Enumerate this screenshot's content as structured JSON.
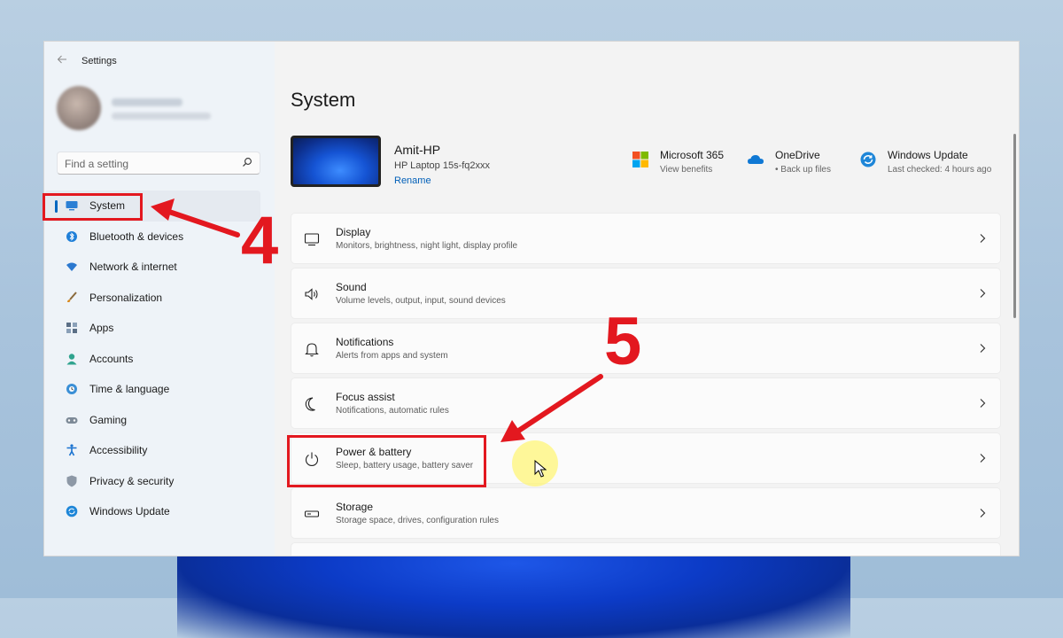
{
  "window": {
    "title": "Settings"
  },
  "sidebar": {
    "search_placeholder": "Find a setting",
    "items": [
      {
        "label": "System",
        "icon": "monitor-icon",
        "selected": true
      },
      {
        "label": "Bluetooth & devices",
        "icon": "bluetooth-icon"
      },
      {
        "label": "Network & internet",
        "icon": "wifi-icon"
      },
      {
        "label": "Personalization",
        "icon": "brush-icon"
      },
      {
        "label": "Apps",
        "icon": "apps-icon"
      },
      {
        "label": "Accounts",
        "icon": "person-icon"
      },
      {
        "label": "Time & language",
        "icon": "globe-clock-icon"
      },
      {
        "label": "Gaming",
        "icon": "gamepad-icon"
      },
      {
        "label": "Accessibility",
        "icon": "accessibility-icon"
      },
      {
        "label": "Privacy & security",
        "icon": "shield-icon"
      },
      {
        "label": "Windows Update",
        "icon": "update-icon"
      }
    ]
  },
  "main": {
    "title": "System",
    "device": {
      "name": "Amit-HP",
      "model": "HP Laptop 15s-fq2xxx",
      "rename_label": "Rename"
    },
    "quick_links": [
      {
        "title": "Microsoft 365",
        "sub": "View benefits",
        "icon": "microsoft-logo-icon"
      },
      {
        "title": "OneDrive",
        "sub": "• Back up files",
        "icon": "onedrive-cloud-icon"
      },
      {
        "title": "Windows Update",
        "sub": "Last checked: 4 hours ago",
        "icon": "update-icon"
      }
    ],
    "settings": [
      {
        "title": "Display",
        "sub": "Monitors, brightness, night light, display profile",
        "icon": "display-icon"
      },
      {
        "title": "Sound",
        "sub": "Volume levels, output, input, sound devices",
        "icon": "speaker-icon"
      },
      {
        "title": "Notifications",
        "sub": "Alerts from apps and system",
        "icon": "bell-icon"
      },
      {
        "title": "Focus assist",
        "sub": "Notifications, automatic rules",
        "icon": "moon-icon"
      },
      {
        "title": "Power & battery",
        "sub": "Sleep, battery usage, battery saver",
        "icon": "power-icon"
      },
      {
        "title": "Storage",
        "sub": "Storage space, drives, configuration rules",
        "icon": "storage-icon"
      }
    ]
  },
  "annotations": {
    "step4": "4",
    "step5": "5"
  },
  "colors": {
    "accent": "#0067c0",
    "annotation": "#e3181f"
  }
}
